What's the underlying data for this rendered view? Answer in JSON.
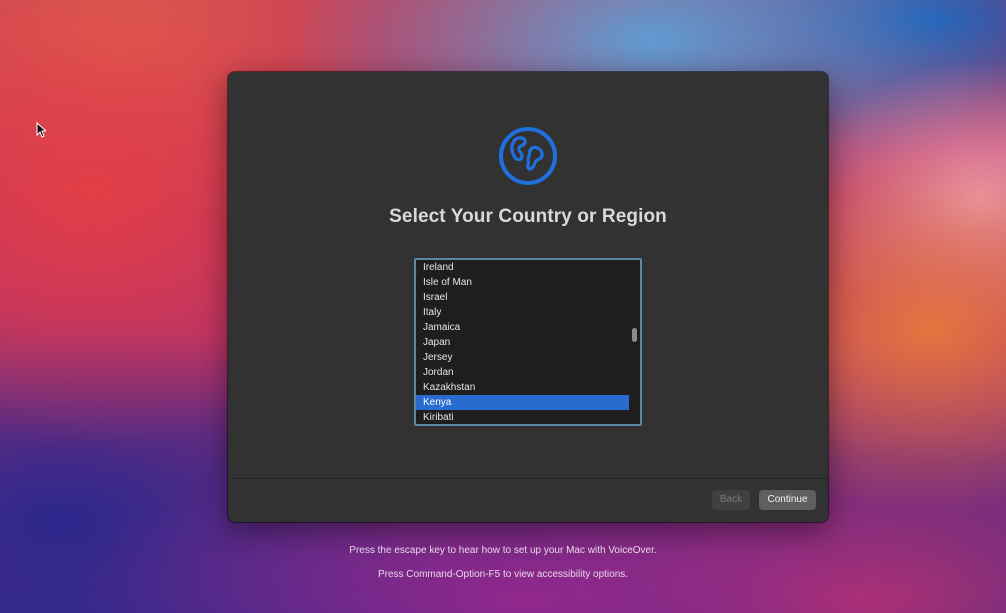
{
  "setup": {
    "title": "Select Your Country or Region",
    "icon": "globe-icon",
    "accent_color": "#2a6bd0",
    "countries": [
      "Ireland",
      "Isle of Man",
      "Israel",
      "Italy",
      "Jamaica",
      "Japan",
      "Jersey",
      "Jordan",
      "Kazakhstan",
      "Kenya",
      "Kiribati"
    ],
    "selected_country": "Kenya",
    "buttons": {
      "back_label": "Back",
      "continue_label": "Continue"
    }
  },
  "hints": {
    "voiceover": "Press the escape key to hear how to set up your Mac with VoiceOver.",
    "accessibility": "Press Command-Option-F5 to view accessibility options."
  }
}
